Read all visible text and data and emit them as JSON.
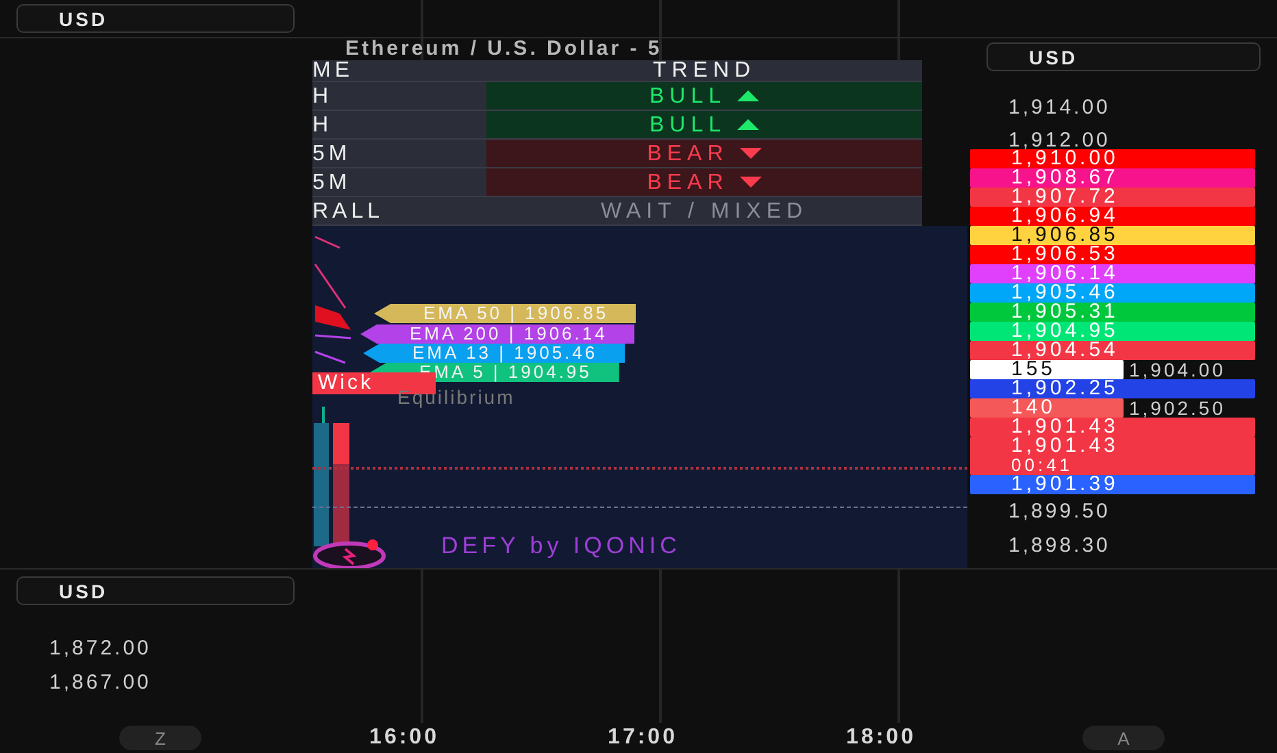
{
  "top_left": {
    "currency_button": "USD"
  },
  "title": "Ethereum / U.S. Dollar - 5",
  "trend_table": {
    "columns": [
      "ME",
      "TREND"
    ],
    "rows": [
      {
        "timeframe": "H",
        "trend": "BULL",
        "kind": "bull"
      },
      {
        "timeframe": "H",
        "trend": "BULL",
        "kind": "bull"
      },
      {
        "timeframe": "5M",
        "trend": "BEAR",
        "kind": "bear"
      },
      {
        "timeframe": "5M",
        "trend": "BEAR",
        "kind": "bear"
      },
      {
        "timeframe": "RALL",
        "trend": "WAIT / MIXED",
        "kind": "mixed"
      }
    ]
  },
  "chart": {
    "ema_labels": [
      {
        "text": "EMA 50 | 1906.85",
        "color": "#d4b85a"
      },
      {
        "text": "EMA 200 | 1906.14",
        "color": "#b342e8"
      },
      {
        "text": "EMA 13 | 1905.46",
        "color": "#0aa0f0"
      },
      {
        "text": "EMA 5 | 1904.95",
        "color": "#10c27e"
      }
    ],
    "wick_tag": "Wick",
    "equilibrium_label": "Equilibrium",
    "watermark": "DEFY by IQONIC"
  },
  "price_axis": {
    "currency_button": "USD",
    "ticks_above": [
      "1,914.00",
      "1,912.00"
    ],
    "tags": [
      {
        "text": "1,910.00",
        "color": "#ff0000"
      },
      {
        "text": "1,908.67",
        "color": "#f7138c"
      },
      {
        "text": "1,907.72",
        "color": "#f23645"
      },
      {
        "text": "1,906.94",
        "color": "#ff0000"
      },
      {
        "text": "1,906.85",
        "color": "#ffd23f"
      },
      {
        "text": "1,906.53",
        "color": "#ff0000"
      },
      {
        "text": "1,906.14",
        "color": "#e040fb"
      },
      {
        "text": "1,905.46",
        "color": "#00a6f7"
      },
      {
        "text": "1,905.31",
        "color": "#00c83c"
      },
      {
        "text": "1,904.95",
        "color": "#00e676"
      },
      {
        "text": "1,904.54",
        "color": "#f23645"
      },
      {
        "text": "155",
        "color": "#ffffff",
        "kind": "short",
        "axis_label": "1,904.00"
      },
      {
        "text": "1,902.25",
        "color": "#2343e6"
      },
      {
        "text": "140",
        "color": "#f55858",
        "kind": "short",
        "axis_label": "1,902.50"
      },
      {
        "text": "1,901.43",
        "color": "#f23645"
      },
      {
        "text": "1,901.43",
        "color": "#f23645",
        "countdown": "00:41"
      },
      {
        "text": "1,901.39",
        "color": "#2962ff"
      }
    ],
    "ticks_below": [
      "1,899.50",
      "1,898.30"
    ]
  },
  "lower_pane": {
    "currency_button": "USD",
    "ticks": [
      "1,872.00",
      "1,867.00"
    ]
  },
  "time_axis": [
    "16:00",
    "17:00",
    "18:00"
  ],
  "scale_buttons": [
    "Z",
    "A"
  ]
}
